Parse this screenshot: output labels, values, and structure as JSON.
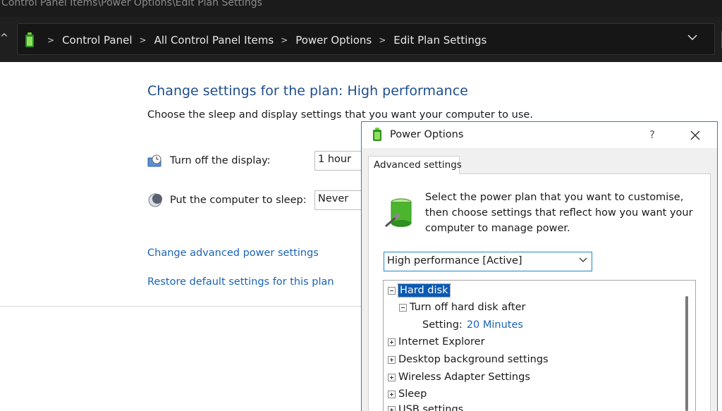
{
  "window": {
    "title_path": "Control Panel Items\\Power Options\\Edit Plan Settings"
  },
  "address_bar": {
    "crumbs": [
      "Control Panel",
      "All Control Panel Items",
      "Power Options",
      "Edit Plan Settings"
    ]
  },
  "main": {
    "title": "Change settings for the plan: High performance",
    "subtitle": "Choose the sleep and display settings that you want your computer to use.",
    "display_label": "Turn off the display:",
    "display_value": "1 hour",
    "sleep_label": "Put the computer to sleep:",
    "sleep_value": "Never",
    "link_advanced": "Change advanced power settings",
    "link_restore": "Restore default settings for this plan"
  },
  "dialog": {
    "title": "Power Options",
    "help": "?",
    "tab": "Advanced settings",
    "description": "Select the power plan that you want to customise, then choose settings that reflect how you want your computer to manage power.",
    "plan_select": "High performance [Active]",
    "tree": {
      "hard_disk": "Hard disk",
      "turn_off_hd": "Turn off hard disk after",
      "setting_label": "Setting:",
      "setting_value": "20 Minutes",
      "internet_explorer": "Internet Explorer",
      "desktop_bg": "Desktop background settings",
      "wireless": "Wireless Adapter Settings",
      "sleep": "Sleep",
      "usb": "USB settings"
    }
  },
  "colors": {
    "accent_blue": "#1e87c8",
    "title_blue": "#1e4e8c",
    "link_blue": "#1a64b4",
    "selection": "#0a5ab4"
  }
}
